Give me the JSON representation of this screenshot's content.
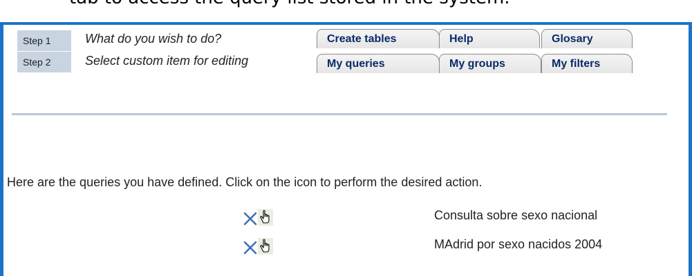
{
  "caption": {
    "text": "tab to access the query list stored in the system."
  },
  "steps": [
    {
      "label": "Step 1",
      "description": "What do you wish to do?"
    },
    {
      "label": "Step 2",
      "description": "Select custom item for editing"
    }
  ],
  "tabs_row1": [
    {
      "label": "Create tables"
    },
    {
      "label": "Help"
    },
    {
      "label": "Glosary"
    }
  ],
  "tabs_row2": [
    {
      "label": "My queries"
    },
    {
      "label": "My groups"
    },
    {
      "label": "My filters"
    }
  ],
  "intro_text": "Here are the queries you have defined. Click on the icon to perform the desired action.",
  "queries": [
    {
      "name": "Consulta sobre sexo nacional",
      "delete_icon": "delete-x-icon",
      "edit_icon": "hand-pointer-icon"
    },
    {
      "name": "MAdrid por sexo nacidos 2004",
      "delete_icon": "delete-x-icon",
      "edit_icon": "hand-pointer-icon"
    }
  ],
  "colors": {
    "frame_border": "#1a73c7",
    "step_label_bg": "#c8d4e2",
    "tab_text": "#0a2a66",
    "delete_icon": "#3f6fb3",
    "separator": "#b9c6d8"
  }
}
